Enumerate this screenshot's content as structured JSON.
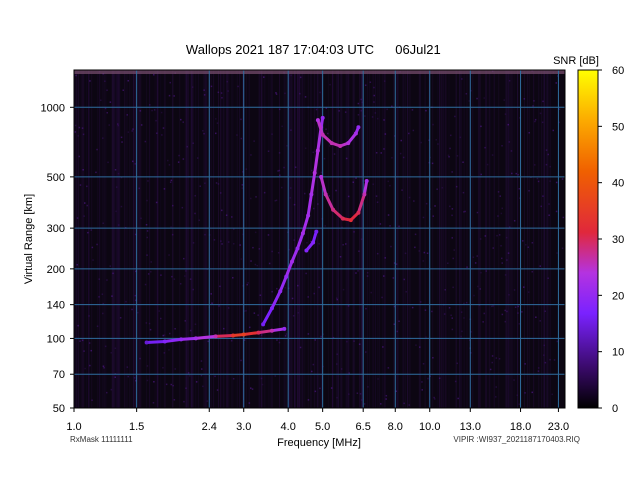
{
  "chart_data": {
    "type": "heatmap",
    "title": "Wallops 2021 187 17:04:03 UTC",
    "date": "06Jul21",
    "xlabel": "Frequency [MHz]",
    "ylabel": "Virtual Range [km]",
    "x_scale": "log",
    "y_scale": "log",
    "xlim": [
      1.0,
      24.0
    ],
    "ylim": [
      50,
      1450
    ],
    "x_ticks": [
      1.0,
      1.5,
      2.4,
      3.0,
      4.0,
      5.0,
      6.5,
      8.0,
      10.0,
      13.0,
      18.0,
      23.0
    ],
    "x_tick_labels": [
      "1.0",
      "1.5",
      "2.4",
      "3.0",
      "4.0",
      "5.0",
      "6.5",
      "8.0",
      "10.0",
      "13.0",
      "18.0",
      "23.0"
    ],
    "y_ticks": [
      50,
      70,
      100,
      140,
      200,
      300,
      500,
      1000
    ],
    "y_tick_labels": [
      "50",
      "70",
      "100",
      "140",
      "200",
      "300",
      "500",
      "1000"
    ],
    "grid": true,
    "colorbar": {
      "label": "SNR [dB]",
      "min": 0,
      "max": 60,
      "ticks": [
        0,
        10,
        20,
        30,
        40,
        50,
        60
      ],
      "tick_labels": [
        "0",
        "10",
        "20",
        "30",
        "40",
        "50",
        "60"
      ]
    },
    "traces": [
      {
        "points": [
          [
            1.6,
            96
          ],
          [
            1.8,
            97
          ],
          [
            2.0,
            99
          ],
          [
            2.2,
            100
          ],
          [
            2.5,
            102
          ],
          [
            2.8,
            103
          ],
          [
            3.0,
            104
          ],
          [
            3.3,
            106
          ],
          [
            3.6,
            108
          ],
          [
            3.9,
            110
          ]
        ],
        "snr": [
          14,
          18,
          20,
          22,
          26,
          34,
          36,
          30,
          26,
          20
        ]
      },
      {
        "points": [
          [
            3.4,
            115
          ],
          [
            3.6,
            135
          ],
          [
            3.8,
            160
          ],
          [
            3.95,
            185
          ],
          [
            4.1,
            215
          ],
          [
            4.25,
            245
          ],
          [
            4.4,
            285
          ],
          [
            4.55,
            340
          ],
          [
            4.65,
            420
          ],
          [
            4.75,
            520
          ],
          [
            4.85,
            650
          ],
          [
            4.95,
            820
          ],
          [
            5.0,
            900
          ]
        ],
        "snr": [
          16,
          18,
          20,
          20,
          22,
          20,
          22,
          22,
          22,
          24,
          24,
          22,
          20
        ]
      },
      {
        "points": [
          [
            4.85,
            880
          ],
          [
            5.0,
            760
          ],
          [
            5.3,
            700
          ],
          [
            5.6,
            680
          ],
          [
            5.9,
            700
          ],
          [
            6.2,
            770
          ],
          [
            6.3,
            820
          ]
        ],
        "snr": [
          24,
          26,
          26,
          26,
          24,
          22,
          20
        ]
      },
      {
        "points": [
          [
            4.95,
            500
          ],
          [
            5.1,
            420
          ],
          [
            5.35,
            360
          ],
          [
            5.7,
            330
          ],
          [
            6.0,
            325
          ],
          [
            6.3,
            350
          ],
          [
            6.55,
            420
          ],
          [
            6.65,
            480
          ]
        ],
        "snr": [
          24,
          26,
          28,
          30,
          32,
          30,
          26,
          22
        ]
      },
      {
        "points": [
          [
            4.5,
            240
          ],
          [
            4.7,
            260
          ],
          [
            4.8,
            290
          ]
        ],
        "snr": [
          18,
          18,
          16
        ]
      }
    ]
  },
  "footer": {
    "rxmask": "RxMask 11111111",
    "filename": "VIPIR :WI937_2021187170403.RIQ"
  }
}
